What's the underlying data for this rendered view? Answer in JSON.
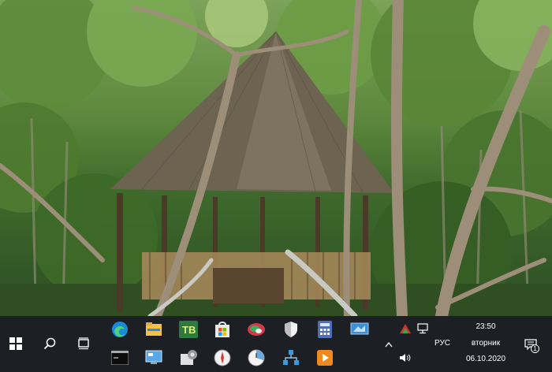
{
  "taskbar": {
    "start": "start-button",
    "search": "search-button",
    "task_view": "task-view-button",
    "pinned_row1": [
      {
        "name": "edge",
        "icon": "edge-icon"
      },
      {
        "name": "file-explorer",
        "icon": "folder-icon"
      },
      {
        "name": "teambox",
        "icon": "tb-icon"
      },
      {
        "name": "store",
        "icon": "store-icon"
      },
      {
        "name": "photos",
        "icon": "photos-icon"
      },
      {
        "name": "security",
        "icon": "shield-icon"
      },
      {
        "name": "calculator",
        "icon": "calculator-icon"
      },
      {
        "name": "screen-app",
        "icon": "screen-icon"
      }
    ],
    "pinned_row2": [
      {
        "name": "terminal",
        "icon": "terminal-icon"
      },
      {
        "name": "control-panel",
        "icon": "control-panel-icon"
      },
      {
        "name": "settings-tool",
        "icon": "gear-app-icon"
      },
      {
        "name": "compass",
        "icon": "compass-icon"
      },
      {
        "name": "clock-app",
        "icon": "clock-app-icon"
      },
      {
        "name": "network-tool",
        "icon": "network-icon"
      },
      {
        "name": "media-player",
        "icon": "player-icon"
      }
    ],
    "tray": {
      "language": "РУС",
      "time": "23:50",
      "weekday": "вторник",
      "date": "06.10.2020",
      "notification_count": "1"
    }
  }
}
